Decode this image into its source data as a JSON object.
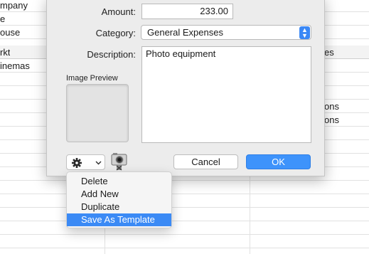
{
  "background_table": {
    "header": {
      "col1": "rkt",
      "col3": "es"
    },
    "rows": [
      {
        "col1": "mpany",
        "col3": ""
      },
      {
        "col1": "e",
        "col3": ""
      },
      {
        "col1": "ouse",
        "col3": ""
      },
      {
        "col1": "",
        "col3": ""
      },
      {
        "col1": "inemas",
        "col3": ""
      },
      {
        "col1": "",
        "col3": ""
      },
      {
        "col1": "",
        "col3": ""
      },
      {
        "col1": "",
        "col3": "ons"
      },
      {
        "col1": "",
        "col3": "ons"
      }
    ]
  },
  "dialog": {
    "amount_label": "Amount:",
    "amount_value": "233.00",
    "category_label": "Category:",
    "category_value": "General Expenses",
    "description_label": "Description:",
    "description_value": "Photo equipment",
    "image_preview_label": "Image Preview",
    "cancel_label": "Cancel",
    "ok_label": "OK",
    "gear_icon": "gear-icon",
    "camera_icon": "camera-icon"
  },
  "menu": {
    "items": [
      {
        "label": "Delete"
      },
      {
        "label": "Add New"
      },
      {
        "label": "Duplicate"
      },
      {
        "label": "Save As Template"
      }
    ],
    "selected_index": 3
  },
  "colors": {
    "accent": "#3b8af5",
    "dialog_bg": "#ececec"
  }
}
